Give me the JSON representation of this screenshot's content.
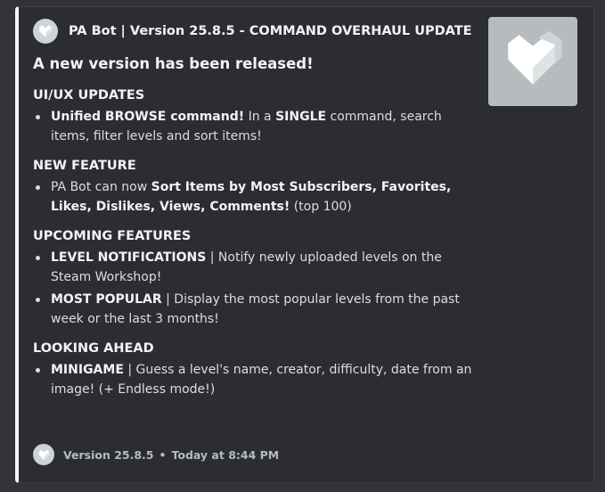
{
  "author": {
    "name": "PA Bot | Version 25.8.5 - COMMAND OVERHAUL UPDATE",
    "icon": "heart-logo-icon"
  },
  "thumbnail": {
    "icon": "heart-logo-icon"
  },
  "headline": "A new version has been released!",
  "sections": [
    {
      "title": "UI/UX UPDATES",
      "items": [
        {
          "parts": [
            {
              "bold": true,
              "text": "Unified BROWSE command!"
            },
            {
              "bold": false,
              "text": " In a "
            },
            {
              "bold": true,
              "text": "SINGLE"
            },
            {
              "bold": false,
              "text": " command, search items, filter levels and sort items!"
            }
          ]
        }
      ]
    },
    {
      "title": "NEW FEATURE",
      "items": [
        {
          "parts": [
            {
              "bold": false,
              "text": "PA Bot can now "
            },
            {
              "bold": true,
              "text": "Sort Items by Most Subscribers, Favorites, Likes, Dislikes, Views, Comments!"
            },
            {
              "bold": false,
              "text": " (top 100)"
            }
          ]
        }
      ]
    },
    {
      "title": "UPCOMING FEATURES",
      "items": [
        {
          "parts": [
            {
              "bold": true,
              "text": "LEVEL NOTIFICATIONS"
            },
            {
              "bold": false,
              "text": " | Notify newly uploaded levels on the Steam Workshop!"
            }
          ]
        },
        {
          "parts": [
            {
              "bold": true,
              "text": "MOST POPULAR"
            },
            {
              "bold": false,
              "text": " | Display the most popular levels from the past week or the last 3 months!"
            }
          ]
        }
      ]
    },
    {
      "title": "LOOKING AHEAD",
      "items": [
        {
          "parts": [
            {
              "bold": true,
              "text": "MINIGAME"
            },
            {
              "bold": false,
              "text": " | Guess a level's name, creator, difficulty, date from an image! (+ Endless mode!)"
            }
          ]
        }
      ]
    }
  ],
  "footer": {
    "version": "Version 25.8.5",
    "separator": "•",
    "timestamp": "Today at 8:44 PM",
    "icon": "heart-logo-icon"
  },
  "colors": {
    "background": "#313338",
    "embed_background": "#2b2d31",
    "embed_accent": "#f2f3f5",
    "text": "#dbdee1",
    "heading": "#f2f3f5",
    "muted": "#b5bac1"
  }
}
